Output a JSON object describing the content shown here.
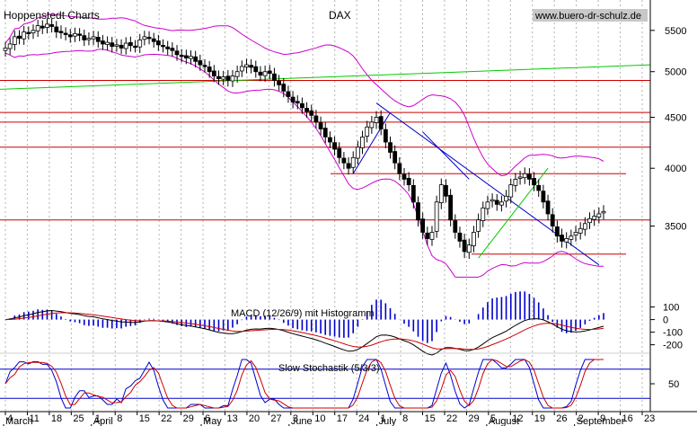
{
  "header": {
    "left": "Hoppenstedt Charts",
    "center": "DAX",
    "right": "www.buero-dr-schulz.de"
  },
  "colors": {
    "background": "#ffffff",
    "grid": "#b4b4b4",
    "candle_up": "#ffffff",
    "candle_down": "#000000",
    "bollinger": "#cc00cc",
    "horizontal_levels": "#cc0000",
    "trend_long": "#00cc00",
    "trend_rise": "#00cc00",
    "trend_down": "#0000cc",
    "macd_line": "#000000",
    "macd_signal": "#cc0000",
    "macd_hist": "#0000cc",
    "stoch_k": "#0000cc",
    "stoch_d": "#cc0000",
    "stoch_level": "#0000cc"
  },
  "chart_data": [
    {
      "type": "candlestick",
      "title": "DAX",
      "ylim": [
        3100,
        5900
      ],
      "y_ticks": [
        3500,
        4000,
        4500,
        5000,
        5500
      ],
      "grid": true,
      "x_day_ticks": [
        "4",
        "11",
        "18",
        "25",
        "1",
        "8",
        "15",
        "22",
        "29",
        "6",
        "13",
        "20",
        "27",
        "3",
        "10",
        "17",
        "24",
        "1",
        "8",
        "15",
        "22",
        "29",
        "5",
        "12",
        "19",
        "26",
        "2",
        "9",
        "16",
        "23"
      ],
      "months": [
        "March",
        "April",
        "May",
        "June",
        "July",
        "August",
        "September"
      ],
      "close": [
        5280,
        5330,
        5420,
        5400,
        5480,
        5460,
        5500,
        5560,
        5530,
        5580,
        5550,
        5480,
        5470,
        5450,
        5420,
        5460,
        5440,
        5380,
        5400,
        5420,
        5360,
        5330,
        5350,
        5300,
        5320,
        5280,
        5340,
        5310,
        5300,
        5380,
        5420,
        5400,
        5360,
        5320,
        5300,
        5270,
        5250,
        5200,
        5180,
        5160,
        5180,
        5120,
        5080,
        5060,
        5000,
        4950,
        4920,
        4940,
        4900,
        4950,
        5000,
        5060,
        5080,
        5050,
        5000,
        4960,
        5000,
        4980,
        4900,
        4850,
        4780,
        4720,
        4660,
        4650,
        4600,
        4560,
        4520,
        4450,
        4380,
        4300,
        4250,
        4180,
        4100,
        4050,
        4000,
        4100,
        4200,
        4300,
        4400,
        4450,
        4500,
        4380,
        4250,
        4150,
        4050,
        3950,
        3900,
        3850,
        3700,
        3550,
        3450,
        3400,
        3450,
        3700,
        3850,
        3750,
        3550,
        3450,
        3380,
        3300,
        3350,
        3450,
        3550,
        3650,
        3700,
        3720,
        3680,
        3700,
        3750,
        3850,
        3900,
        3920,
        3950,
        3900,
        3850,
        3800,
        3700,
        3600,
        3500,
        3420,
        3380,
        3400,
        3420,
        3450,
        3480,
        3520,
        3560,
        3580,
        3600,
        3620
      ]
    },
    {
      "type": "line",
      "title": "MACD (12/26/9) mit Histogramm",
      "y_ticks": [
        100,
        0,
        -100,
        -200
      ],
      "ylim": [
        -260,
        140
      ]
    },
    {
      "type": "line",
      "title": "Slow Stochastik (5/3/3)",
      "y_ticks": [
        50
      ],
      "ylim": [
        0,
        100
      ],
      "level": 80
    }
  ],
  "levels": [
    4900,
    4550,
    4450,
    4200,
    3950,
    3550,
    3280
  ]
}
